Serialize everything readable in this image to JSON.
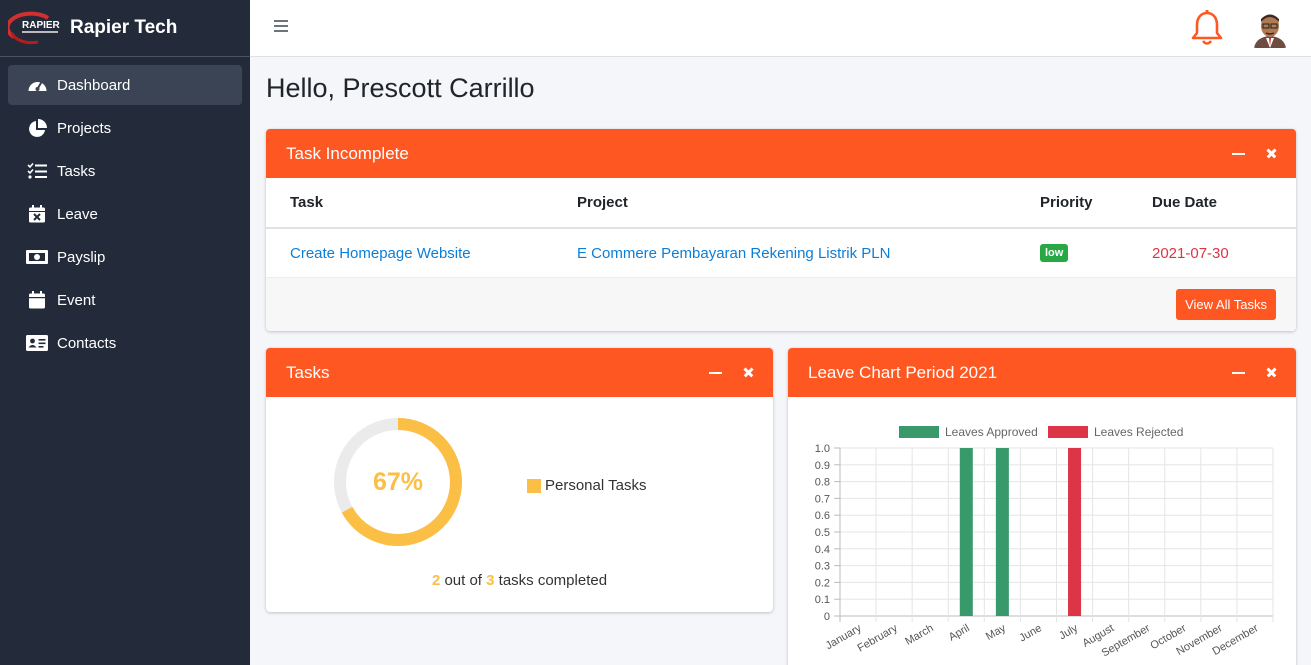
{
  "brand": {
    "name": "Rapier Tech",
    "logo_text": "RAPIER"
  },
  "sidebar": {
    "items": [
      {
        "label": "Dashboard",
        "icon": "tachometer-icon",
        "active": true
      },
      {
        "label": "Projects",
        "icon": "pie-chart-icon"
      },
      {
        "label": "Tasks",
        "icon": "tasks-icon"
      },
      {
        "label": "Leave",
        "icon": "calendar-x-icon"
      },
      {
        "label": "Payslip",
        "icon": "money-bill-icon"
      },
      {
        "label": "Event",
        "icon": "calendar-icon"
      },
      {
        "label": "Contacts",
        "icon": "id-card-icon"
      }
    ]
  },
  "topbar": {
    "menu_icon": "hamburger-icon",
    "bell_icon": "bell-icon",
    "avatar_icon": "user-avatar"
  },
  "greeting": "Hello, Prescott Carrillo",
  "task_incomplete": {
    "title": "Task Incomplete",
    "columns": [
      "Task",
      "Project",
      "Priority",
      "Due Date"
    ],
    "rows": [
      {
        "task": "Create Homepage Website",
        "project": "E Commere Pembayaran Rekening Listrik PLN",
        "priority": "low",
        "due_date": "2021-07-30"
      }
    ],
    "view_all_label": "View All Tasks"
  },
  "tasks_card": {
    "title": "Tasks",
    "percent_label": "67%",
    "percent_value": 0.67,
    "legend_label": "Personal Tasks",
    "completed_count": "2",
    "completed_mid": " out of ",
    "total_count": "3",
    "completed_suffix": " tasks completed"
  },
  "leave_card": {
    "title": "Leave Chart Period 2021"
  },
  "colors": {
    "accent": "#ff5722",
    "approved": "#38996a",
    "rejected": "#dc3545",
    "personal": "#fbbf45"
  },
  "chart_data": {
    "type": "bar",
    "categories": [
      "January",
      "February",
      "March",
      "April",
      "May",
      "June",
      "July",
      "August",
      "September",
      "October",
      "November",
      "December"
    ],
    "series": [
      {
        "name": "Leaves Approved",
        "values": [
          0,
          0,
          0,
          1,
          1,
          0,
          0,
          0,
          0,
          0,
          0,
          0
        ]
      },
      {
        "name": "Leaves Rejected",
        "values": [
          0,
          0,
          0,
          0,
          0,
          0,
          1,
          0,
          0,
          0,
          0,
          0
        ]
      }
    ],
    "ylim": [
      0,
      1
    ],
    "yticks": [
      "0",
      "0.1",
      "0.2",
      "0.3",
      "0.4",
      "0.5",
      "0.6",
      "0.7",
      "0.8",
      "0.9",
      "1.0"
    ],
    "grid": true,
    "legend": "top"
  }
}
